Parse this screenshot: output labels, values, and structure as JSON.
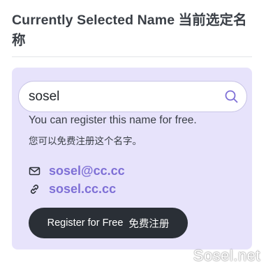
{
  "heading": {
    "title": "Currently Selected Name 当前选定名称"
  },
  "search": {
    "value": "sosel",
    "icon": "search-icon"
  },
  "status": {
    "message_en": "You can register this name for free.",
    "message_zh": "您可以免费注册这个名字。"
  },
  "contacts": {
    "email": "sosel@cc.cc",
    "website": "sosel.cc.cc",
    "email_icon": "mail-icon",
    "link_icon": "link-icon"
  },
  "register_button": {
    "label_en": "Register for Free",
    "label_zh": "免费注册"
  },
  "watermark": "Sosel.net",
  "colors": {
    "panel_bg": "#e7e3fb",
    "accent": "#7e6fd6",
    "button_bg": "#2a2f36",
    "text": "#3a3f46"
  }
}
